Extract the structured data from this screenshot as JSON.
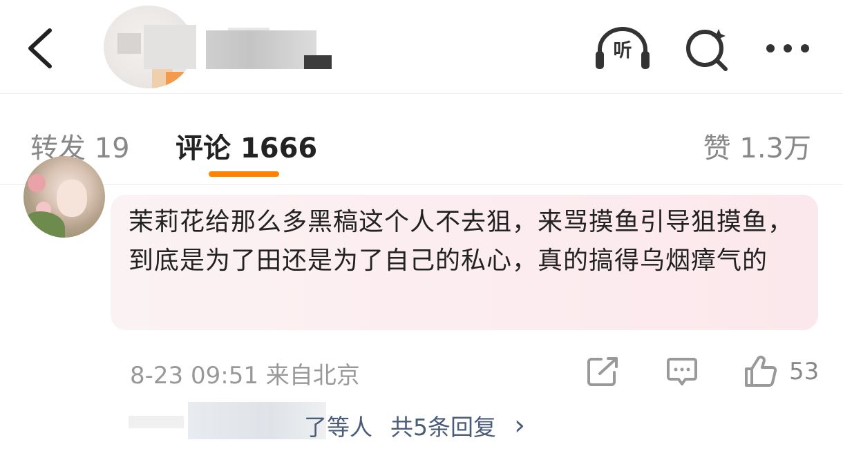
{
  "header": {
    "back_icon": "chevron-left-icon",
    "listen_label": "听",
    "listen_icon": "headphones-icon",
    "search_icon": "search-sparkle-icon",
    "more_icon": "more-dots-icon"
  },
  "tabs": [
    {
      "label": "转发 19"
    },
    {
      "label": "评论 1666"
    },
    {
      "label": "赞 1.3万"
    }
  ],
  "colors": {
    "accent": "#ff8200",
    "reply_link": "#4b5c78",
    "bubble": "#fcecef"
  },
  "comment": {
    "text": "茉莉花给那么多黑稿这个人不去狙，来骂摸鱼引导狙摸鱼，到底是为了田还是为了自己的私心，真的搞得乌烟瘴气的",
    "meta": "8-23 09:51 来自北京",
    "like_count": "53",
    "replies_prefix": "了等人",
    "replies_count": "共5条回复",
    "replies_chevron": "›"
  }
}
